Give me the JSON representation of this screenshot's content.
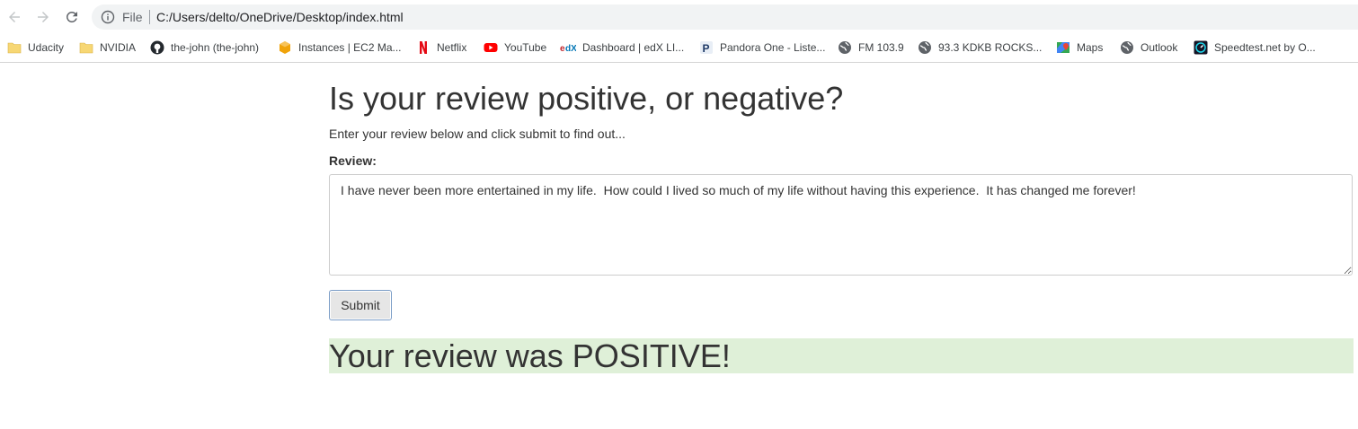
{
  "browser": {
    "url_scheme": "File",
    "url": "C:/Users/delto/OneDrive/Desktop/index.html",
    "bookmarks": [
      {
        "label": "Udacity",
        "icon": "folder-icon"
      },
      {
        "label": "NVIDIA",
        "icon": "folder-icon"
      },
      {
        "label": "the-john (the-john)",
        "icon": "github-icon"
      },
      {
        "label": "Instances | EC2 Ma...",
        "icon": "aws-icon"
      },
      {
        "label": "Netflix",
        "icon": "netflix-icon"
      },
      {
        "label": "YouTube",
        "icon": "youtube-icon"
      },
      {
        "label": "Dashboard | edX LI...",
        "icon": "edx-icon"
      },
      {
        "label": "Pandora One - Liste...",
        "icon": "pandora-icon"
      },
      {
        "label": "FM 103.9",
        "icon": "globe-icon"
      },
      {
        "label": "93.3 KDKB ROCKS...",
        "icon": "globe-icon"
      },
      {
        "label": "Maps",
        "icon": "maps-icon"
      },
      {
        "label": "Outlook",
        "icon": "globe-icon"
      },
      {
        "label": "Speedtest.net by O...",
        "icon": "speedtest-icon"
      }
    ]
  },
  "page": {
    "title": "Is your review positive, or negative?",
    "intro": "Enter your review below and click submit to find out...",
    "review_label": "Review:",
    "review_text": "I have never been more entertained in my life.  How could I lived so much of my life without having this experience.  It has changed me forever!",
    "submit_label": "Submit",
    "result_text": "Your review was POSITIVE!",
    "result_color": "#dff0d8"
  }
}
